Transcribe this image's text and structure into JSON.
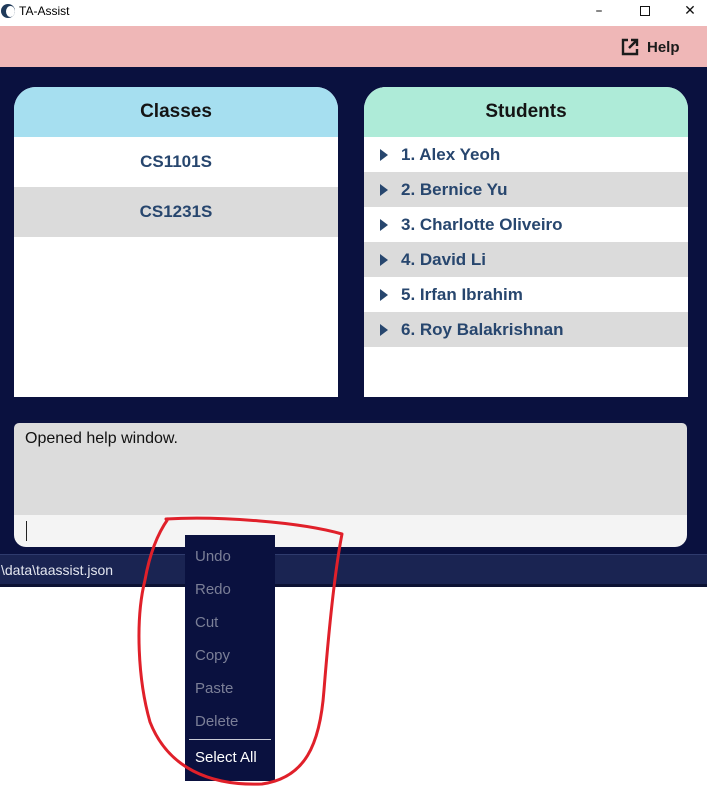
{
  "window": {
    "title": "TA-Assist",
    "controls": {
      "minimize": "–",
      "close": "✕"
    }
  },
  "menu": {
    "help_label": "Help"
  },
  "classes_panel": {
    "title": "Classes",
    "items": [
      "CS1101S",
      "CS1231S"
    ]
  },
  "students_panel": {
    "title": "Students",
    "items": [
      "1. Alex Yeoh",
      "2. Bernice Yu",
      "3. Charlotte Oliveiro",
      "4. David Li",
      "5. Irfan Ibrahim",
      "6. Roy Balakrishnan"
    ]
  },
  "result": {
    "text": "Opened help window."
  },
  "command": {
    "value": ""
  },
  "status": {
    "path": "\\data\\taassist.json"
  },
  "context_menu": {
    "items": [
      "Undo",
      "Redo",
      "Cut",
      "Copy",
      "Paste",
      "Delete"
    ],
    "select_all": "Select All"
  },
  "colors": {
    "menubar": "#efb7b7",
    "main_bg": "#0a113f",
    "classes_header": "#a6dff0",
    "students_header": "#aeebd8",
    "list_text": "#27466e",
    "annotation": "#e0202a"
  },
  "icons": {
    "help": "external-link-icon",
    "app": "app-logo-icon"
  }
}
